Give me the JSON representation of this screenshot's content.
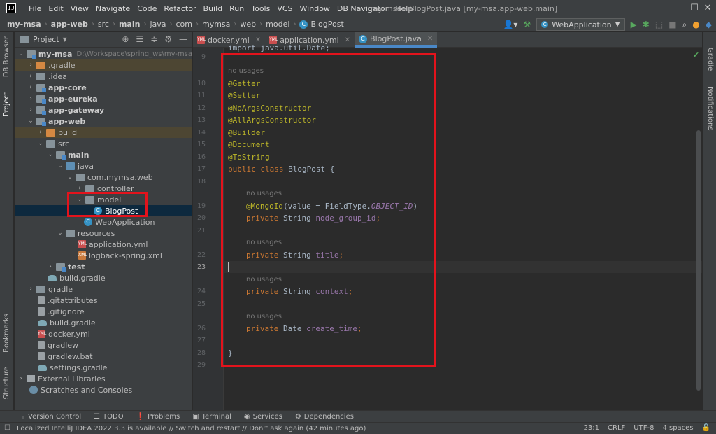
{
  "window": {
    "title": "my-msa - BlogPost.java [my-msa.app-web.main]",
    "minimize": "—",
    "maximize": "☐",
    "close": "✕"
  },
  "app_logo": "IJ",
  "menu": [
    "File",
    "Edit",
    "View",
    "Navigate",
    "Code",
    "Refactor",
    "Build",
    "Run",
    "Tools",
    "VCS",
    "Window",
    "DB Navigator",
    "Help"
  ],
  "breadcrumb": [
    "my-msa",
    "app-web",
    "src",
    "main",
    "java",
    "com",
    "mymsa",
    "web",
    "model",
    "BlogPost"
  ],
  "run_config": "WebApplication",
  "left_strip": {
    "db_browser": "DB Browser",
    "project": "Project",
    "bookmarks": "Bookmarks",
    "structure": "Structure"
  },
  "right_strip": {
    "gradle": "Gradle",
    "notifications": "Notifications"
  },
  "project_panel": {
    "title": "Project"
  },
  "tree": [
    {
      "label": "my-msa",
      "path": "D:\\Workspace\\spring_ws\\my-msa",
      "bold": true
    },
    {
      "label": ".gradle"
    },
    {
      "label": ".idea"
    },
    {
      "label": "app-core",
      "bold": true
    },
    {
      "label": "app-eureka",
      "bold": true
    },
    {
      "label": "app-gateway",
      "bold": true
    },
    {
      "label": "app-web",
      "bold": true
    },
    {
      "label": "build"
    },
    {
      "label": "src"
    },
    {
      "label": "main",
      "bold": true
    },
    {
      "label": "java"
    },
    {
      "label": "com.mymsa.web"
    },
    {
      "label": "controller"
    },
    {
      "label": "model"
    },
    {
      "label": "BlogPost"
    },
    {
      "label": "WebApplication"
    },
    {
      "label": "resources"
    },
    {
      "label": "application.yml"
    },
    {
      "label": "logback-spring.xml"
    },
    {
      "label": "test",
      "bold": true
    },
    {
      "label": "build.gradle"
    },
    {
      "label": "gradle"
    },
    {
      "label": ".gitattributes"
    },
    {
      "label": ".gitignore"
    },
    {
      "label": "build.gradle"
    },
    {
      "label": "docker.yml"
    },
    {
      "label": "gradlew"
    },
    {
      "label": "gradlew.bat"
    },
    {
      "label": "settings.gradle"
    },
    {
      "label": "External Libraries"
    },
    {
      "label": "Scratches and Consoles"
    }
  ],
  "editor_tabs": [
    "docker.yml",
    "application.yml",
    "BlogPost.java"
  ],
  "line_numbers": [
    "9",
    "10",
    "11",
    "12",
    "13",
    "14",
    "15",
    "16",
    "17",
    "18",
    "19",
    "20",
    "21",
    "22",
    "23",
    "24",
    "25",
    "26",
    "27",
    "28",
    "29"
  ],
  "hint": "no usages",
  "code": {
    "import_line": "import java.util.Date;",
    "getter": "@Getter",
    "setter": "@Setter",
    "noargs": "@NoArgsConstructor",
    "allargs": "@AllArgsConstructor",
    "builder": "@Builder",
    "document": "@Document",
    "tostring": "@ToString",
    "class_kw": "public class",
    "class_rest": " BlogPost {",
    "mongoid_ann": "@MongoId",
    "mongoid_args": "(value = FieldType.",
    "mongoid_const": "OBJECT_ID",
    "mongoid_close": ")",
    "private_kw": "private",
    "string_type": " String ",
    "date_type": " Date ",
    "field1": "node_group_id",
    "field2": "title",
    "field3": "context",
    "field4": "create_time",
    "semicolon": ";",
    "close_brace": "}"
  },
  "bottom_tools": [
    "Version Control",
    "TODO",
    "Problems",
    "Terminal",
    "Services",
    "Dependencies"
  ],
  "status": {
    "message": "Localized IntelliJ IDEA 2022.3.3 is available // Switch and restart // Don't ask again (42 minutes ago)",
    "position": "23:1",
    "line_sep": "CRLF",
    "encoding": "UTF-8",
    "indent": "4 spaces"
  }
}
